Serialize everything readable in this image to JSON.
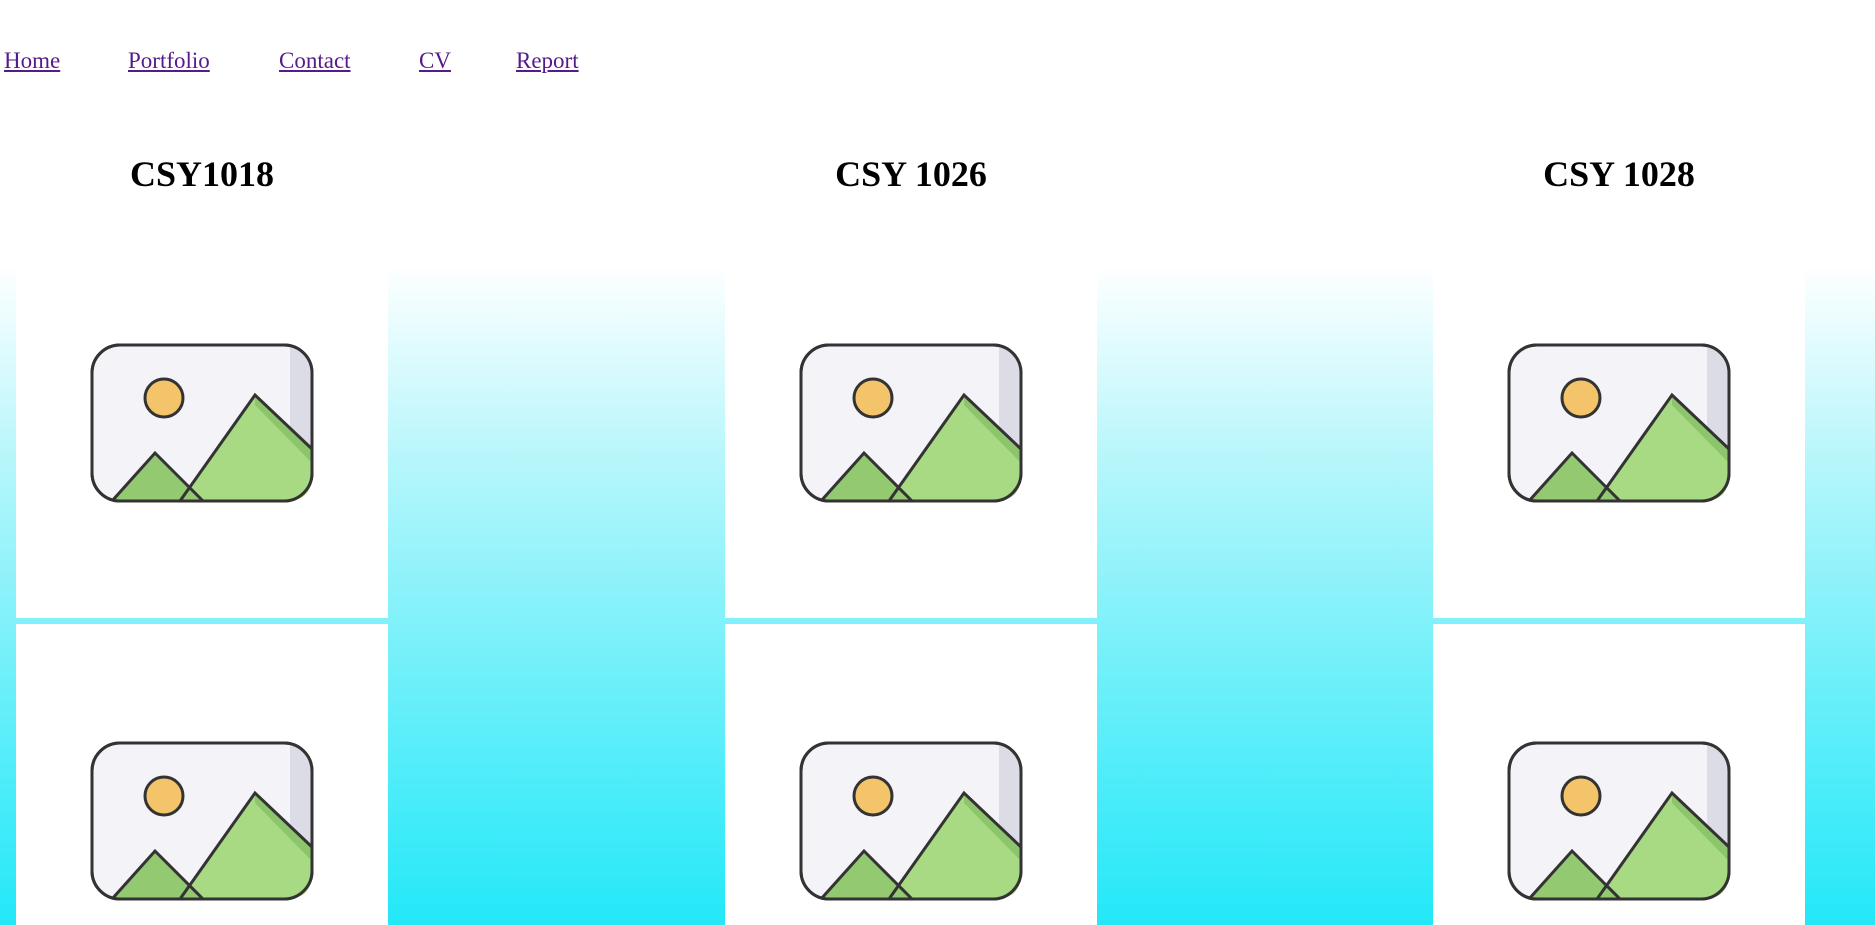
{
  "nav": {
    "links": [
      "Home",
      "Portfolio",
      "Contact",
      "CV",
      "Report"
    ]
  },
  "columns": [
    {
      "title": "CSY1018"
    },
    {
      "title": "CSY 1026"
    },
    {
      "title": "CSY 1028"
    }
  ],
  "icons": {
    "card_image": "image-placeholder-icon"
  },
  "colors": {
    "link": "#551a8b",
    "gradient_top": "#ffffff",
    "gradient_bottom": "#23e8f8",
    "sun": "#f4c46a",
    "mountain": "#a8d983",
    "frame": "#f3f3f8"
  }
}
